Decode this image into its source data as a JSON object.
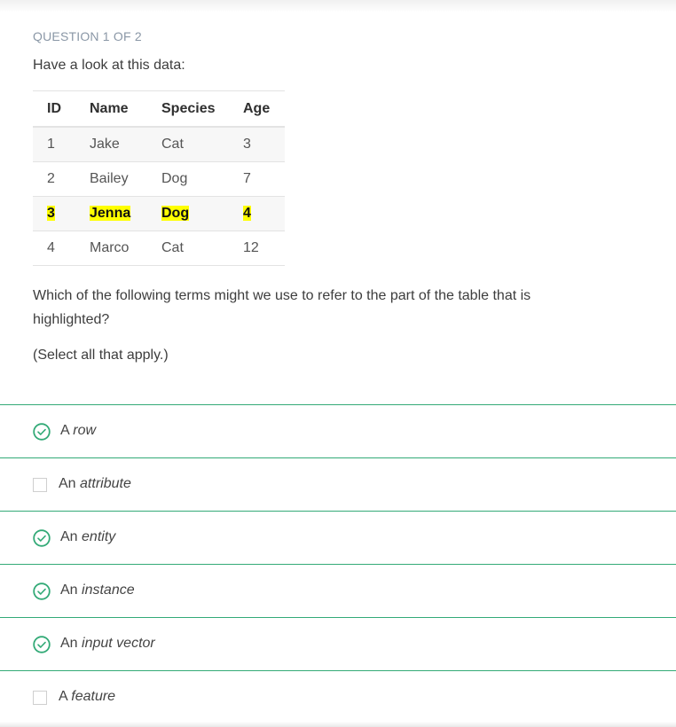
{
  "question": {
    "counter": "QUESTION 1 OF 2",
    "intro": "Have a look at this data:",
    "prompt": "Which of the following terms might we use to refer to the part of the table that is highlighted?",
    "hint": "(Select all that apply.)"
  },
  "table": {
    "headers": [
      "ID",
      "Name",
      "Species",
      "Age"
    ],
    "rows": [
      {
        "id": "1",
        "name": "Jake",
        "species": "Cat",
        "age": "3"
      },
      {
        "id": "2",
        "name": "Bailey",
        "species": "Dog",
        "age": "7"
      },
      {
        "id": "3",
        "name": "Jenna",
        "species": "Dog",
        "age": "4",
        "highlighted": true
      },
      {
        "id": "4",
        "name": "Marco",
        "species": "Cat",
        "age": "12"
      }
    ]
  },
  "options": [
    {
      "prefix": "A",
      "term": "row",
      "selected": true
    },
    {
      "prefix": "An",
      "term": "attribute",
      "selected": false
    },
    {
      "prefix": "An",
      "term": "entity",
      "selected": true
    },
    {
      "prefix": "An",
      "term": "instance",
      "selected": true
    },
    {
      "prefix": "An",
      "term": "input vector",
      "selected": true
    },
    {
      "prefix": "A",
      "term": "feature",
      "selected": false
    }
  ],
  "colors": {
    "accent": "#33aa77",
    "highlight": "#ffff00",
    "muted": "#8a97a6"
  }
}
